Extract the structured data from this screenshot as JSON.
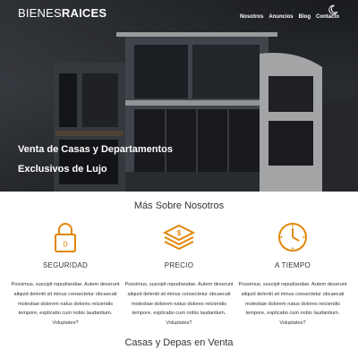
{
  "brand": {
    "light": "BIENES",
    "bold": "RAICES"
  },
  "nav": {
    "items": [
      "Nosotros",
      "Anuncios",
      "Blog",
      "Contacto"
    ]
  },
  "theme_toggle_icon": "moon-icon",
  "hero": {
    "line1": "Venta de Casas y Departamentos",
    "line2": "Exclusivos de Lujo"
  },
  "about": {
    "title": "Más Sobre Nosotros",
    "features": [
      {
        "icon": "lock-icon",
        "title": "SEGURIDAD",
        "text": "Possimus, suscipit repudiandae. Autem deserunt aliquid deleniti sit minus consectetur obcaecati molestiae dolorem natus dolores reiciendis tempore, explicabo cum nobis laudantium. Voluptates?"
      },
      {
        "icon": "money-icon",
        "title": "PRECIO",
        "text": "Possimus, suscipit repudiandae. Autem deserunt aliquid deleniti sit minus consectetur obcaecati molestiae dolorem natus dolores reiciendis tempore, explicabo cum nobis laudantium. Voluptates?"
      },
      {
        "icon": "clock-icon",
        "title": "A TIEMPO",
        "text": "Possimus, suscipit repudiandae. Autem deserunt aliquid deleniti sit minus consectetur obcaecati molestiae dolorem natus dolores reiciendis tempore, explicabo cum nobis laudantium. Voluptates?"
      }
    ]
  },
  "sale": {
    "title": "Casas y Depas en Venta"
  },
  "colors": {
    "accent": "#E08709",
    "text": "#333333",
    "white": "#FFFFFF"
  }
}
